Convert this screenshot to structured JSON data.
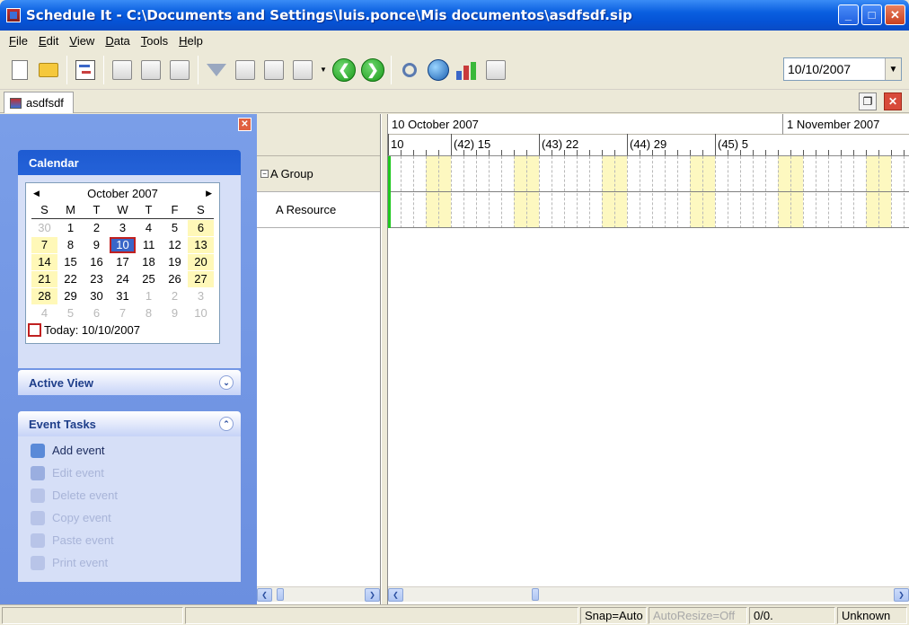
{
  "window": {
    "title": "Schedule It - C:\\Documents and Settings\\luis.ponce\\Mis documentos\\asdfsdf.sip",
    "minimize": "_",
    "maximize": "□",
    "close": "✕"
  },
  "menu": [
    {
      "label": "File",
      "key": "F",
      "rest": "ile"
    },
    {
      "label": "Edit",
      "key": "E",
      "rest": "dit"
    },
    {
      "label": "View",
      "key": "V",
      "rest": "iew"
    },
    {
      "label": "Data",
      "key": "D",
      "rest": "ata"
    },
    {
      "label": "Tools",
      "key": "T",
      "rest": "ools"
    },
    {
      "label": "Help",
      "key": "H",
      "rest": "elp"
    }
  ],
  "toolbar": {
    "date_value": "10/10/2007",
    "back_glyph": "❮",
    "forward_glyph": "❯",
    "dropdown_glyph": "▼"
  },
  "tabs": {
    "doc_tab_label": "asdfsdf",
    "restore_glyph": "❐",
    "close_glyph": "✕"
  },
  "taskpane": {
    "close_glyph": "✕",
    "calendar": {
      "header": "Calendar",
      "month_label": "October 2007",
      "prev_glyph": "◀",
      "next_glyph": "▶",
      "weekdays": [
        "S",
        "M",
        "T",
        "W",
        "T",
        "F",
        "S"
      ],
      "weeks": [
        [
          "30",
          "1",
          "2",
          "3",
          "4",
          "5",
          "6"
        ],
        [
          "7",
          "8",
          "9",
          "10",
          "11",
          "12",
          "13"
        ],
        [
          "14",
          "15",
          "16",
          "17",
          "18",
          "19",
          "20"
        ],
        [
          "21",
          "22",
          "23",
          "24",
          "25",
          "26",
          "27"
        ],
        [
          "28",
          "29",
          "30",
          "31",
          "1",
          "2",
          "3"
        ],
        [
          "4",
          "5",
          "6",
          "7",
          "8",
          "9",
          "10"
        ]
      ],
      "selected_day": "10",
      "today_label": "Today: 10/10/2007"
    },
    "active_view": {
      "header": "Active View",
      "toggle_glyph": "⌄"
    },
    "event_tasks": {
      "header": "Event Tasks",
      "toggle_glyph": "⌃",
      "items": [
        {
          "label": "Add event",
          "enabled": true
        },
        {
          "label": "Edit event",
          "enabled": false
        },
        {
          "label": "Delete event",
          "enabled": false
        },
        {
          "label": "Copy event",
          "enabled": false
        },
        {
          "label": "Paste event",
          "enabled": false
        },
        {
          "label": "Print event",
          "enabled": false
        }
      ]
    }
  },
  "resources": {
    "group_label": "A Group",
    "expand_glyph": "−",
    "resource_label": "A Resource"
  },
  "timeline": {
    "months": [
      "10 October 2007",
      "1 November 2007"
    ],
    "weeks": [
      "10",
      "(42) 15",
      "(43) 22",
      "(44) 29",
      "(45) 5"
    ]
  },
  "scroll": {
    "left_glyph": "❮",
    "right_glyph": "❯"
  },
  "status": {
    "snap": "Snap=Auto",
    "autoresize": "AutoResize=Off",
    "position": "0/0.",
    "state": "Unknown"
  },
  "colors": {
    "weekend_band": "#fdf8c0",
    "now_line": "#1ec81e",
    "selected_day_border": "#c02020"
  }
}
